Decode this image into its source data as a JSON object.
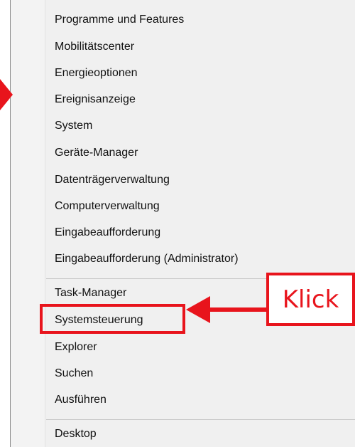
{
  "menu": {
    "items_group1": [
      "Programme und Features",
      "Mobilitätscenter",
      "Energieoptionen",
      "Ereignisanzeige",
      "System",
      "Geräte-Manager",
      "Datenträgerverwaltung",
      "Computerverwaltung",
      "Eingabeaufforderung",
      "Eingabeaufforderung (Administrator)"
    ],
    "items_group2": [
      "Task-Manager",
      "Systemsteuerung",
      "Explorer",
      "Suchen",
      "Ausführen"
    ],
    "items_group3": [
      "Desktop"
    ]
  },
  "annotation": {
    "label": "Klick",
    "color": "#e8141c"
  }
}
